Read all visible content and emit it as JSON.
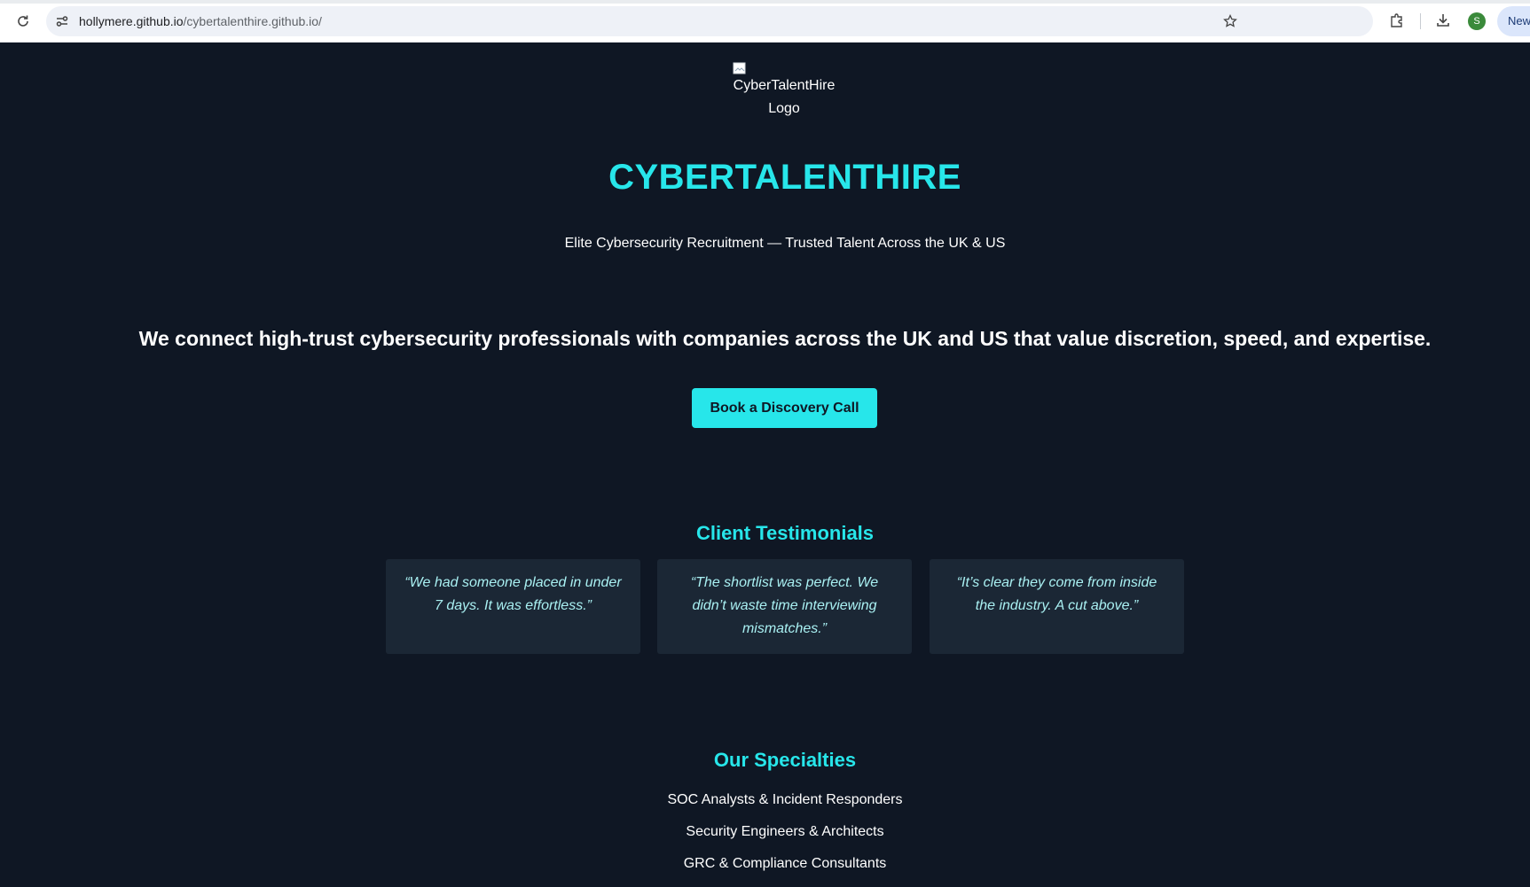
{
  "browser": {
    "url_host": "hollymere.github.io",
    "url_path": "/cybertalenthire.github.io/",
    "profile_initial": "S",
    "new_label": "New"
  },
  "logo": {
    "alt": "CyberTalentHire Logo"
  },
  "hero": {
    "brand": "CYBERTALENTHIRE",
    "tagline": "Elite Cybersecurity Recruitment — Trusted Talent Across the UK & US",
    "headline": "We connect high-trust cybersecurity professionals with companies across the UK and US that value discretion, speed, and expertise.",
    "cta_label": "Book a Discovery Call"
  },
  "testimonials": {
    "title": "Client Testimonials",
    "items": [
      {
        "quote": "“We had someone placed in under 7 days. It was effortless.”"
      },
      {
        "quote": "“The shortlist was perfect. We didn’t waste time interviewing mismatches.”"
      },
      {
        "quote": "“It’s clear they come from inside the industry. A cut above.”"
      }
    ]
  },
  "specialties": {
    "title": "Our Specialties",
    "items": [
      "SOC Analysts & Incident Responders",
      "Security Engineers & Architects",
      "GRC & Compliance Consultants"
    ]
  },
  "colors": {
    "page_bg": "#0f1724",
    "accent": "#27e6ea",
    "card_bg": "#1b2735",
    "quote_text": "#a9f0f2"
  }
}
